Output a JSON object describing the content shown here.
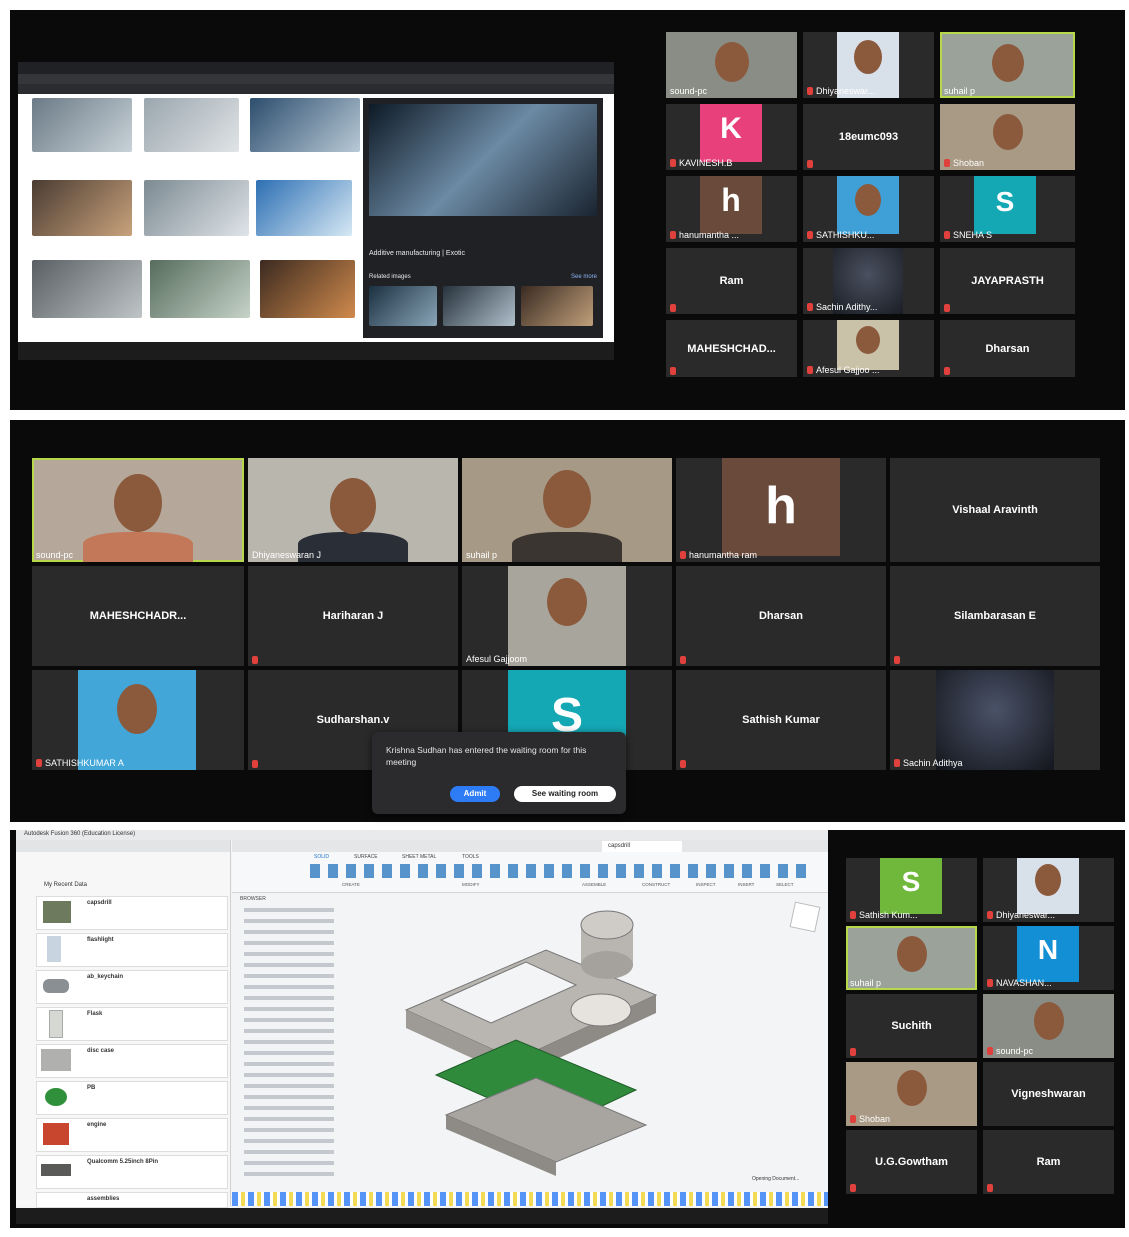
{
  "meeting1": {
    "browser": {
      "result_title": "Additive manufacturing | Exotic",
      "related_label": "Related images",
      "see_more": "See more"
    },
    "participants": [
      {
        "name": "sound-pc"
      },
      {
        "name": "Dhiyaneswar..."
      },
      {
        "name": "suhail p"
      },
      {
        "name": "KAVINESH.B",
        "letter": "K"
      },
      {
        "name": "18eumc093"
      },
      {
        "name": "Shoban"
      },
      {
        "name": "hanumantha ...",
        "letter": "h"
      },
      {
        "name": "SATHISHKU..."
      },
      {
        "name": "SNEHA S",
        "letter": "S"
      },
      {
        "name": "Ram"
      },
      {
        "name": "Sachin Adithy..."
      },
      {
        "name": "JAYAPRASTH"
      },
      {
        "name": "MAHESHCHAD..."
      },
      {
        "name": "Afesul Gajjoo ..."
      },
      {
        "name": "Dharsan"
      }
    ]
  },
  "meeting2": {
    "participants": [
      {
        "name": "sound-pc"
      },
      {
        "name": "Dhiyaneswaran J"
      },
      {
        "name": "suhail p"
      },
      {
        "name": "hanumantha ram",
        "letter": "h"
      },
      {
        "name": "Vishaal Aravinth"
      },
      {
        "name": "MAHESHCHADR..."
      },
      {
        "name": "Hariharan J"
      },
      {
        "name": "Afesul Gajjoom"
      },
      {
        "name": "Dharsan"
      },
      {
        "name": "Silambarasan E"
      },
      {
        "name": "SATHISHKUMAR A"
      },
      {
        "name": "Sudharshan.v"
      },
      {
        "name": "S",
        "letter": "S"
      },
      {
        "name": "Sathish Kumar"
      },
      {
        "name": "Sachin Adithya"
      }
    ],
    "waiting_popup": {
      "message": "Krishna Sudhan has entered the waiting room for this meeting",
      "admit": "Admit",
      "see_room": "See waiting room"
    }
  },
  "meeting3": {
    "cad": {
      "title": "Autodesk Fusion 360 (Education License)",
      "project": "My Recent Data",
      "tab": "capsdrill",
      "browser_label": "BROWSER",
      "status": "Opening Document...",
      "menus": [
        "SOLID",
        "SURFACE",
        "SHEET METAL",
        "TOOLS"
      ],
      "groups": [
        "CREATE",
        "MODIFY",
        "ASSEMBLE",
        "CONSTRUCT",
        "INSPECT",
        "INSERT",
        "SELECT"
      ],
      "files": [
        "capsdrill",
        "flashlight",
        "ab_keychain",
        "Flask",
        "disc case",
        "PB",
        "engine",
        "Qualcomm 5.25inch 8Pin",
        "assemblies"
      ]
    },
    "participants": [
      {
        "name": "Sathish Kum...",
        "letter": "S"
      },
      {
        "name": "Dhiyaneswar..."
      },
      {
        "name": "suhail p"
      },
      {
        "name": "NAVASHAN...",
        "letter": "N"
      },
      {
        "name": "Suchith"
      },
      {
        "name": "sound-pc"
      },
      {
        "name": "Shoban"
      },
      {
        "name": "Vigneshwaran"
      },
      {
        "name": "U.G.Gowtham"
      },
      {
        "name": "Ram"
      }
    ]
  },
  "colors": {
    "active_border": "#b7d84a",
    "admit_button": "#2d7cf6",
    "mic_muted": "#e0413c"
  }
}
